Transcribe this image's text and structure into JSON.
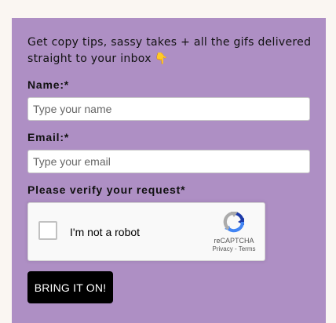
{
  "form": {
    "intro_text": "Get copy tips, sassy takes + all the gifs delivered straight to your inbox",
    "intro_emoji": "👇",
    "name_label": "Name:*",
    "name_placeholder": "Type your name",
    "name_value": "",
    "email_label": "Email:*",
    "email_placeholder": "Type your email",
    "email_value": "",
    "verify_label": "Please verify your request*",
    "submit_label": "BRING IT ON!"
  },
  "recaptcha": {
    "checkbox_label": "I'm not a robot",
    "checked": false,
    "brand": "reCAPTCHA",
    "privacy_link": "Privacy",
    "separator": " - ",
    "terms_link": "Terms",
    "icon": "recaptcha-logo-icon"
  },
  "colors": {
    "page_background": "#faf6f2",
    "panel_background": "#ae8fc4",
    "button_background": "#000000",
    "button_text": "#ffffff"
  }
}
